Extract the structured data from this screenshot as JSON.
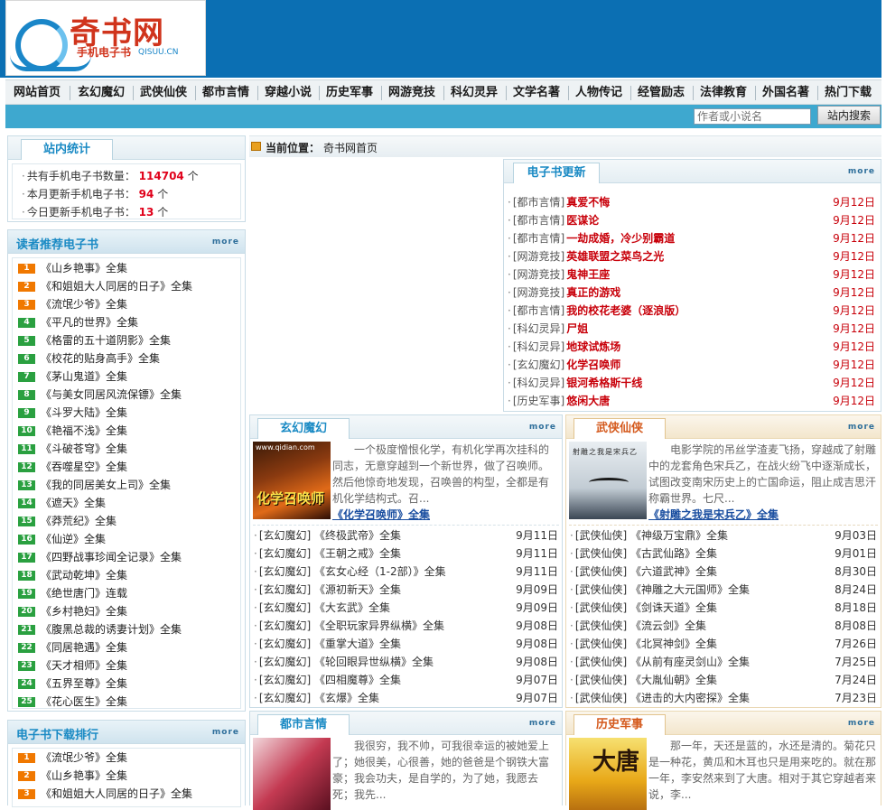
{
  "logo": {
    "title": "奇书网",
    "subtitle": "手机电子书",
    "domain": "QISUU.CN"
  },
  "nav": [
    "网站首页",
    "玄幻魔幻",
    "武侠仙侠",
    "都市言情",
    "穿越小说",
    "历史军事",
    "网游竞技",
    "科幻灵异",
    "文学名著",
    "人物传记",
    "经管励志",
    "法律教育",
    "外国名著",
    "热门下载"
  ],
  "search": {
    "placeholder": "作者或小说名",
    "button": "站内搜索"
  },
  "stats": {
    "title": "站内统计",
    "items": [
      {
        "label": "共有手机电子书数量：",
        "value": "114704",
        "unit": "个"
      },
      {
        "label": "本月更新手机电子书：",
        "value": "94",
        "unit": "个"
      },
      {
        "label": "今日更新手机电子书：",
        "value": "13",
        "unit": "个"
      }
    ]
  },
  "recommend": {
    "title": "读者推荐电子书",
    "more": "more",
    "items": [
      {
        "n": "1",
        "t": "《山乡艳事》全集"
      },
      {
        "n": "2",
        "t": "《和姐姐大人同居的日子》全集"
      },
      {
        "n": "3",
        "t": "《流氓少爷》全集"
      },
      {
        "n": "4",
        "t": "《平凡的世界》全集"
      },
      {
        "n": "5",
        "t": "《格雷的五十道阴影》全集"
      },
      {
        "n": "6",
        "t": "《校花的贴身高手》全集"
      },
      {
        "n": "7",
        "t": "《茅山鬼道》全集"
      },
      {
        "n": "8",
        "t": "《与美女同居风流保镖》全集"
      },
      {
        "n": "9",
        "t": "《斗罗大陆》全集"
      },
      {
        "n": "10",
        "t": "《艳福不浅》全集"
      },
      {
        "n": "11",
        "t": "《斗破苍穹》全集"
      },
      {
        "n": "12",
        "t": "《吞噬星空》全集"
      },
      {
        "n": "13",
        "t": "《我的同居美女上司》全集"
      },
      {
        "n": "14",
        "t": "《遮天》全集"
      },
      {
        "n": "15",
        "t": "《莽荒纪》全集"
      },
      {
        "n": "16",
        "t": "《仙逆》全集"
      },
      {
        "n": "17",
        "t": "《四野战事珍闻全记录》全集"
      },
      {
        "n": "18",
        "t": "《武动乾坤》全集"
      },
      {
        "n": "19",
        "t": "《绝世唐门》连载"
      },
      {
        "n": "20",
        "t": "《乡村艳妇》全集"
      },
      {
        "n": "21",
        "t": "《腹黑总裁的诱妻计划》全集"
      },
      {
        "n": "22",
        "t": "《同居艳遇》全集"
      },
      {
        "n": "23",
        "t": "《天才相师》全集"
      },
      {
        "n": "24",
        "t": "《五界至尊》全集"
      },
      {
        "n": "25",
        "t": "《花心医生》全集"
      }
    ]
  },
  "downloads": {
    "title": "电子书下载排行",
    "more": "more",
    "items": [
      {
        "n": "1",
        "t": "《流氓少爷》全集"
      },
      {
        "n": "2",
        "t": "《山乡艳事》全集"
      },
      {
        "n": "3",
        "t": "《和姐姐大人同居的日子》全集"
      }
    ]
  },
  "location": {
    "label": "当前位置：",
    "value": "奇书网首页"
  },
  "updates": {
    "title": "电子书更新",
    "more": "more",
    "items": [
      {
        "cat": "[都市言情]",
        "title": "真爱不悔",
        "date": "9月12日"
      },
      {
        "cat": "[都市言情]",
        "title": "医谋论",
        "date": "9月12日"
      },
      {
        "cat": "[都市言情]",
        "title": "一劫成婚，冷少别霸道",
        "date": "9月12日"
      },
      {
        "cat": "[网游竞技]",
        "title": "英雄联盟之菜鸟之光",
        "date": "9月12日"
      },
      {
        "cat": "[网游竞技]",
        "title": "鬼神王座",
        "date": "9月12日"
      },
      {
        "cat": "[网游竞技]",
        "title": "真正的游戏",
        "date": "9月12日"
      },
      {
        "cat": "[都市言情]",
        "title": "我的校花老婆（逐浪版）",
        "date": "9月12日"
      },
      {
        "cat": "[科幻灵异]",
        "title": "尸姐",
        "date": "9月12日"
      },
      {
        "cat": "[科幻灵异]",
        "title": "地球试炼场",
        "date": "9月12日"
      },
      {
        "cat": "[玄幻魔幻]",
        "title": "化学召唤师",
        "date": "9月12日"
      },
      {
        "cat": "[科幻灵异]",
        "title": "银河希格斯干线",
        "date": "9月12日"
      },
      {
        "cat": "[历史军事]",
        "title": "悠闲大唐",
        "date": "9月12日"
      }
    ]
  },
  "xuanhuan": {
    "title": "玄幻魔幻",
    "more": "more",
    "cover": "化学召唤师",
    "cover_site": "www.qidian.com",
    "desc": "一个极度憎恨化学，有机化学再次挂科的同志，无意穿越到一个新世界，做了召唤师。然后他惊奇地发现，召唤兽的构型，全都是有机化学结构式。召...",
    "featured": "《化学召唤师》全集",
    "items": [
      {
        "cat": "[玄幻魔幻]",
        "t": "《终极武帝》全集",
        "d": "9月11日"
      },
      {
        "cat": "[玄幻魔幻]",
        "t": "《王朝之戒》全集",
        "d": "9月11日"
      },
      {
        "cat": "[玄幻魔幻]",
        "t": "《玄女心经（1-2部）》全集",
        "d": "9月11日"
      },
      {
        "cat": "[玄幻魔幻]",
        "t": "《源初新天》全集",
        "d": "9月09日"
      },
      {
        "cat": "[玄幻魔幻]",
        "t": "《大玄武》全集",
        "d": "9月09日"
      },
      {
        "cat": "[玄幻魔幻]",
        "t": "《全职玩家异界纵横》全集",
        "d": "9月08日"
      },
      {
        "cat": "[玄幻魔幻]",
        "t": "《重掌大道》全集",
        "d": "9月08日"
      },
      {
        "cat": "[玄幻魔幻]",
        "t": "《轮回眼异世纵横》全集",
        "d": "9月08日"
      },
      {
        "cat": "[玄幻魔幻]",
        "t": "《四相魔尊》全集",
        "d": "9月07日"
      },
      {
        "cat": "[玄幻魔幻]",
        "t": "《玄爆》全集",
        "d": "9月07日"
      }
    ]
  },
  "wuxia": {
    "title": "武侠仙侠",
    "more": "more",
    "cover": "射雕之我是宋兵乙",
    "desc": "电影学院的吊丝学渣麦飞扬，穿越成了射雕中的龙套角色宋兵乙，在战火纷飞中逐渐成长，试图改变南宋历史上的亡国命运，阻止成吉思汗称霸世界。七尺...",
    "featured": "《射雕之我是宋兵乙》全集",
    "items": [
      {
        "cat": "[武侠仙侠]",
        "t": "《神级万宝鼎》全集",
        "d": "9月03日"
      },
      {
        "cat": "[武侠仙侠]",
        "t": "《古武仙路》全集",
        "d": "9月01日"
      },
      {
        "cat": "[武侠仙侠]",
        "t": "《六道武神》全集",
        "d": "8月30日"
      },
      {
        "cat": "[武侠仙侠]",
        "t": "《神雕之大元国师》全集",
        "d": "8月24日"
      },
      {
        "cat": "[武侠仙侠]",
        "t": "《剑诛天道》全集",
        "d": "8月18日"
      },
      {
        "cat": "[武侠仙侠]",
        "t": "《流云剑》全集",
        "d": "8月08日"
      },
      {
        "cat": "[武侠仙侠]",
        "t": "《北冥神剑》全集",
        "d": "7月26日"
      },
      {
        "cat": "[武侠仙侠]",
        "t": "《从前有座灵剑山》全集",
        "d": "7月25日"
      },
      {
        "cat": "[武侠仙侠]",
        "t": "《大胤仙朝》全集",
        "d": "7月24日"
      },
      {
        "cat": "[武侠仙侠]",
        "t": "《进击的大内密探》全集",
        "d": "7月23日"
      }
    ]
  },
  "dushi": {
    "title": "都市言情",
    "more": "more",
    "desc": "我很穷，我不帅，可我很幸运的被她爱上了；她很美，心很善，她的爸爸是个钢铁大富豪；我会功夫，是自学的，为了她，我愿去死；我先..."
  },
  "lishi": {
    "title": "历史军事",
    "more": "more",
    "cover": "大唐",
    "desc": "那一年，天还是蓝的，水还是清的。菊花只是一种花，黄瓜和木耳也只是用来吃的。就在那一年，李安然来到了大唐。相对于其它穿越者来说，李..."
  },
  "colors": {
    "accent": "#1a8ac4",
    "header": "#0b6fb3",
    "searchbar": "#3ea8cf",
    "red": "#c8000a"
  }
}
